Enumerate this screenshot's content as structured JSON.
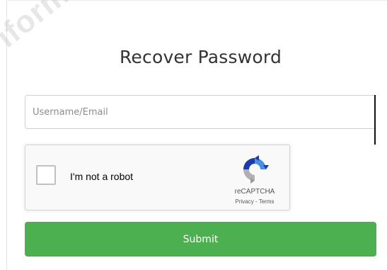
{
  "watermark": {
    "text": "iform"
  },
  "form": {
    "title": "Recover Password",
    "username": {
      "value": "",
      "placeholder": "Username/Email"
    },
    "submit_label": "Submit"
  },
  "recaptcha": {
    "checkbox_label": "I'm not a robot",
    "checked": false,
    "brand": "reCAPTCHA",
    "privacy_label": "Privacy",
    "separator": " - ",
    "terms_label": "Terms",
    "logo_icon": "recaptcha-logo-icon"
  },
  "colors": {
    "submit_background": "#4caf50",
    "recaptcha_blue_dark": "#1c3aa9",
    "recaptcha_blue": "#4a90e2",
    "recaptcha_gray": "#b0b0b0"
  }
}
